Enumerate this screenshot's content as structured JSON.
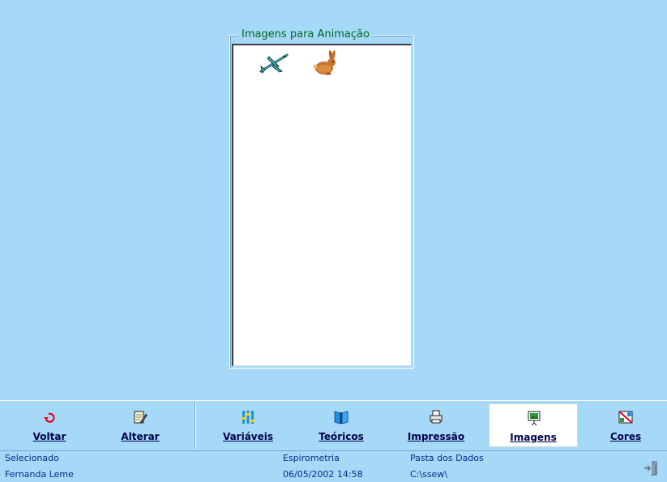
{
  "panel": {
    "title": "Imagens para Animação",
    "items": [
      {
        "icon": "airplane-icon"
      },
      {
        "icon": "rabbit-icon"
      }
    ]
  },
  "toolbar": {
    "buttons": [
      {
        "label": "Voltar",
        "icon": "undo-arrow-icon",
        "active": false
      },
      {
        "label": "Alterar",
        "icon": "edit-document-icon",
        "active": false
      },
      {
        "label": "Variáveis",
        "icon": "variables-icon",
        "active": false
      },
      {
        "label": "Teóricos",
        "icon": "book-icon",
        "active": false
      },
      {
        "label": "Impressão",
        "icon": "printer-icon",
        "active": false
      },
      {
        "label": "Imagens",
        "icon": "picture-easel-icon",
        "active": true
      },
      {
        "label": "Cores",
        "icon": "colors-icon",
        "active": false
      }
    ]
  },
  "status": {
    "selected_label": "Selecionado",
    "user_name": "Fernanda Leme",
    "exam": "Espirometria",
    "datetime": "06/05/2002 14:58",
    "data_folder_label": "Pasta dos Dados",
    "data_folder_path": "C:\\ssew\\"
  },
  "colors": {
    "background": "#a6d8f8",
    "title_green": "#006b1e",
    "status_text": "#0a2a8c"
  }
}
